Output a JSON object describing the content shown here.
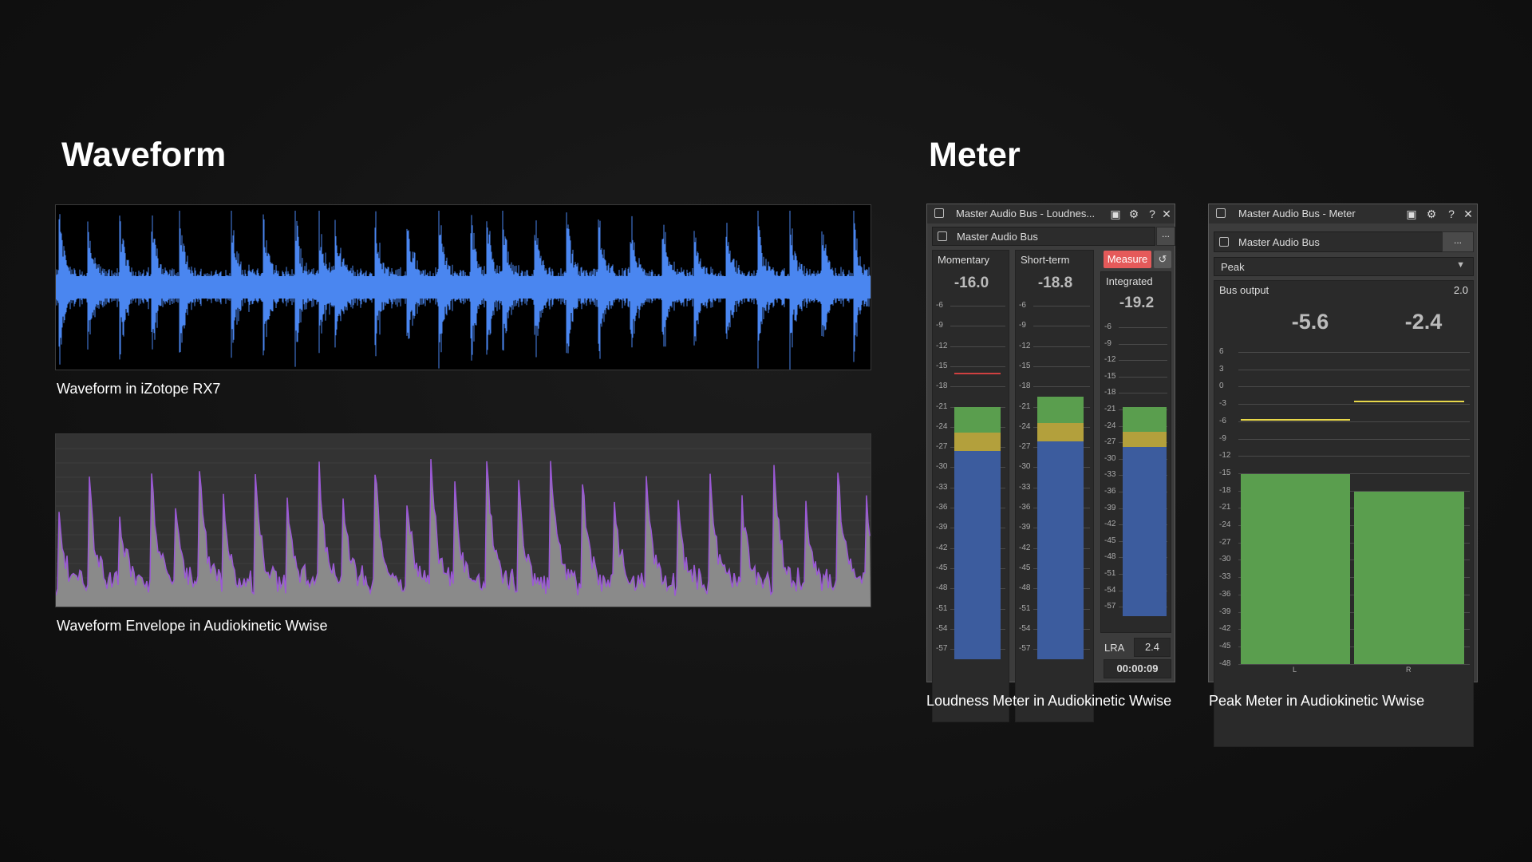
{
  "headings": {
    "waveform": "Waveform",
    "meter": "Meter"
  },
  "captions": {
    "rx": "Waveform in iZotope RX7",
    "wwise_envelope": "Waveform Envelope in Audiokinetic Wwise",
    "loudness": "Loudness Meter in Audiokinetic Wwise",
    "peak": "Peak Meter in Audiokinetic Wwise"
  },
  "colors": {
    "rx_wave": "#4a86f0",
    "envelope_fill": "#8a8a8a",
    "envelope_peak": "#9b59d6",
    "meter_green": "#5a9e4e",
    "meter_yellow": "#b3a03c",
    "meter_blue": "#3c5c9e",
    "measure_button": "#e55a5a",
    "peak_hold": "#e8d84a"
  },
  "loudness_panel": {
    "title": "Master Audio Bus - Loudnes...",
    "bus": "Master Audio Bus",
    "ellipsis": "...",
    "momentary": {
      "label": "Momentary",
      "value": "-16.0"
    },
    "short_term": {
      "label": "Short-term",
      "value": "-18.8"
    },
    "integrated": {
      "label": "Integrated",
      "value": "-19.2"
    },
    "measure_label": "Measure",
    "reset_icon": "reset-icon",
    "lra_label": "LRA",
    "lra_value": "2.4",
    "time": "00:00:09",
    "ticks": [
      "-6",
      "-9",
      "-12",
      "-15",
      "-18",
      "-21",
      "-24",
      "-27",
      "-30",
      "-33",
      "-36",
      "-39",
      "-42",
      "-45",
      "-48",
      "-51",
      "-54",
      "-57"
    ],
    "momentary_level": -21,
    "short_term_level": -19.5,
    "integrated_level": -20.5,
    "momentary_marker": -16
  },
  "peak_panel": {
    "title": "Master Audio Bus - Meter",
    "bus": "Master Audio Bus",
    "ellipsis": "...",
    "mode": "Peak",
    "bus_output_label": "Bus output",
    "bus_output_value": "2.0",
    "left_value": "-5.6",
    "right_value": "-2.4",
    "channel_left": "L",
    "channel_right": "R",
    "ticks": [
      "6",
      "3",
      "0",
      "-3",
      "-6",
      "-9",
      "-12",
      "-15",
      "-18",
      "-21",
      "-24",
      "-27",
      "-30",
      "-33",
      "-36",
      "-39",
      "-42",
      "-45",
      "-48"
    ],
    "left_level": -15.2,
    "right_level": -18.2,
    "left_hold": -5.6,
    "right_hold": -2.4
  }
}
